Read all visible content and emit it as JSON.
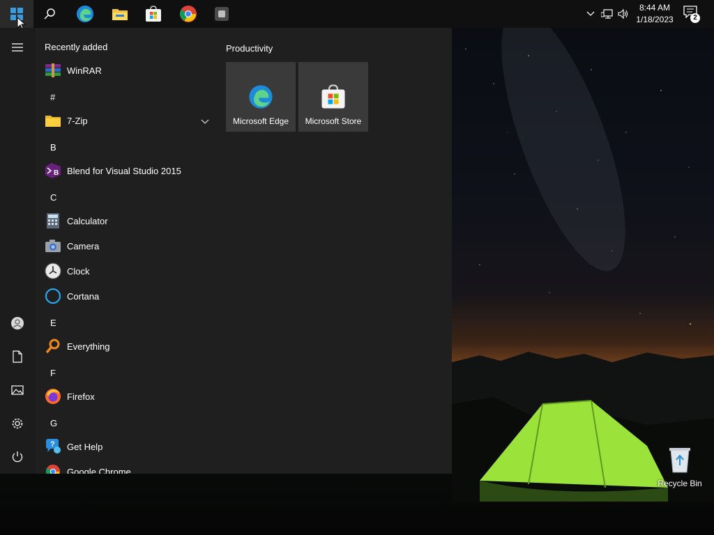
{
  "taskbar": {
    "clock_time": "8:44 AM",
    "clock_date": "1/18/2023",
    "notification_count": "2"
  },
  "start_menu": {
    "recently_added_label": "Recently added",
    "recent_app": "WinRAR",
    "letters": [
      "#",
      "B",
      "C",
      "E",
      "F",
      "G"
    ],
    "apps": {
      "seven_zip": "7-Zip",
      "blend": "Blend for Visual Studio 2015",
      "calculator": "Calculator",
      "camera": "Camera",
      "clock": "Clock",
      "cortana": "Cortana",
      "everything": "Everything",
      "firefox": "Firefox",
      "get_help": "Get Help",
      "google_chrome": "Google Chrome"
    },
    "tiles_group": "Productivity",
    "tiles": [
      "Microsoft Edge",
      "Microsoft Store"
    ]
  },
  "desktop": {
    "recycle_bin_label": "Recycle Bin"
  },
  "colors": {
    "start_bg": "#1f1f1f",
    "taskbar_bg": "#101010",
    "tile_bg": "#3a3a3a",
    "accent_blue": "#0078d4"
  }
}
